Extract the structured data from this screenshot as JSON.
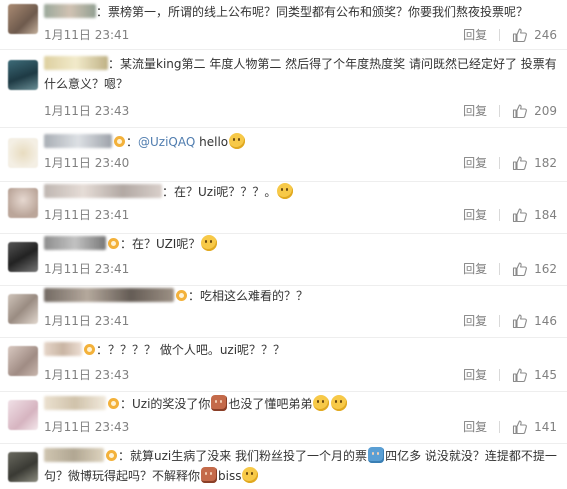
{
  "comments": [
    {
      "text": "：票榜第一，所谓的线上公布呢？同类型都有公布和颁奖？你要我们熬夜投票呢？",
      "date": "1月11日 23:41",
      "reply": "回复",
      "likes": "246"
    },
    {
      "text": "：某流量king第二 年度人物第二 然后得了个年度热度奖 请问既然已经定好了 投票有什么意义？嗯？",
      "date": "1月11日 23:43",
      "reply": "回复",
      "likes": "209"
    },
    {
      "mention": "@UziQAQ",
      "text": " hello",
      "date": "1月11日 23:40",
      "reply": "回复",
      "likes": "182"
    },
    {
      "text": "：在？Uzi呢？？？。",
      "date": "1月11日 23:41",
      "reply": "回复",
      "likes": "184"
    },
    {
      "text": "：在？UZI呢？",
      "date": "1月11日 23:41",
      "reply": "回复",
      "likes": "162"
    },
    {
      "text": "：吃相这么难看的？？",
      "date": "1月11日 23:41",
      "reply": "回复",
      "likes": "146"
    },
    {
      "text": "：？？？？ 做个人吧。uzi呢？？？",
      "date": "1月11日 23:43",
      "reply": "回复",
      "likes": "145"
    },
    {
      "text": "：Uzi的奖没了你",
      "text_b": "也没了懂吧弟弟",
      "date": "1月11日 23:43",
      "reply": "回复",
      "likes": "141"
    },
    {
      "text": "：就算uzi生病了没来 我们粉丝投了一个月的票",
      "text_b": "四亿多 说没就没？连提都不提一句？微博玩得起吗？不解释你",
      "text_c": "biss"
    }
  ],
  "colors": {
    "link": "#507daf",
    "meta": "#808080",
    "text": "#333333"
  },
  "icons": {
    "like": "thumbs-up-icon",
    "verified": "verified-badge-icon"
  }
}
